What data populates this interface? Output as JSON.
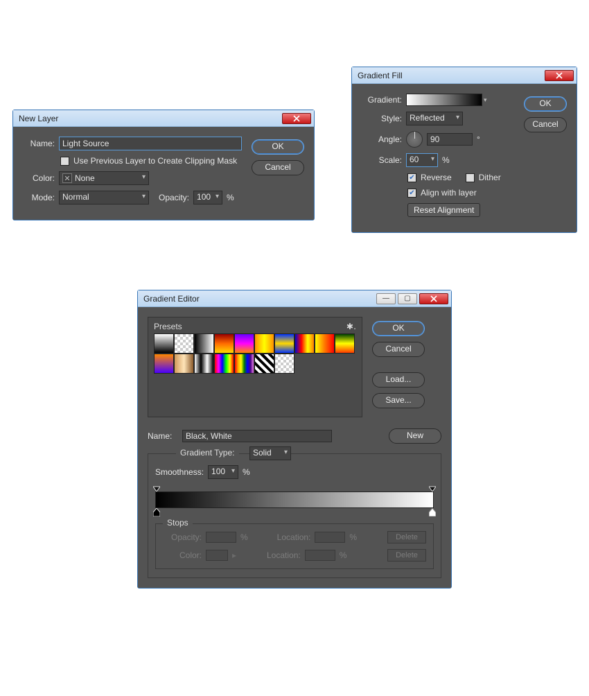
{
  "newLayer": {
    "title": "New Layer",
    "nameLabel": "Name:",
    "nameValue": "Light Source",
    "clipMaskLabel": "Use Previous Layer to Create Clipping Mask",
    "colorLabel": "Color:",
    "colorValue": "None",
    "modeLabel": "Mode:",
    "modeValue": "Normal",
    "opacityLabel": "Opacity:",
    "opacityValue": "100",
    "pct": "%",
    "ok": "OK",
    "cancel": "Cancel"
  },
  "gradientFill": {
    "title": "Gradient Fill",
    "gradientLabel": "Gradient:",
    "styleLabel": "Style:",
    "styleValue": "Reflected",
    "angleLabel": "Angle:",
    "angleValue": "90",
    "degree": "°",
    "scaleLabel": "Scale:",
    "scaleValue": "60",
    "pct": "%",
    "reverseLabel": "Reverse",
    "ditherLabel": "Dither",
    "alignLabel": "Align with layer",
    "resetLabel": "Reset Alignment",
    "ok": "OK",
    "cancel": "Cancel"
  },
  "gradientEditor": {
    "title": "Gradient Editor",
    "presetsLabel": "Presets",
    "ok": "OK",
    "cancel": "Cancel",
    "load": "Load...",
    "save": "Save...",
    "nameLabel": "Name:",
    "nameValue": "Black, White",
    "new": "New",
    "typeLabel": "Gradient Type:",
    "typeValue": "Solid",
    "smoothLabel": "Smoothness:",
    "smoothValue": "100",
    "pct": "%",
    "stopsLabel": "Stops",
    "opacityLabel": "Opacity:",
    "locationLabel": "Location:",
    "colorLabel": "Color:",
    "delete": "Delete"
  },
  "presetSwatches": [
    "linear-gradient(to bottom,#fff,#000)",
    "repeating-conic-gradient(#ccc 0 25%,#fff 0 50%) 0 0/8px 8px",
    "linear-gradient(to right,#000,#fff)",
    "linear-gradient(to bottom,#9a0000,#ff6a00,#ffd800)",
    "linear-gradient(to bottom,#6a00ff,#ff00ff,#ff8a00)",
    "linear-gradient(to right,#ff9000,#ffff00,#ff9000)",
    "linear-gradient(to bottom,#0033ff,#ffd800,#0033ff)",
    "linear-gradient(to right,#0006d1,#ff0000,#ffff00,#ff7b00)",
    "linear-gradient(to right,#ffff00,#ff7800,#ff0000)",
    "linear-gradient(to bottom,#004000,#ffff00,#ff3b00)",
    "linear-gradient(to bottom,#ff8800,#4a00ff)",
    "linear-gradient(to right,#d19a5b,#ffe4b8,#8b5a2b)",
    "linear-gradient(to right,#fff,#000,#fff,#000)",
    "linear-gradient(to right,#ff0000,#ff00ff,#0000ff,#00ff00,#ffff00,#ff0000)",
    "linear-gradient(to right,red,orange,yellow,green,blue,indigo,violet)",
    "repeating-linear-gradient(45deg,#000 0 4px,#fff 4px 8px)",
    "repeating-conic-gradient(#ccc 0 25%,#fff 0 50%) 0 0/8px 8px"
  ]
}
